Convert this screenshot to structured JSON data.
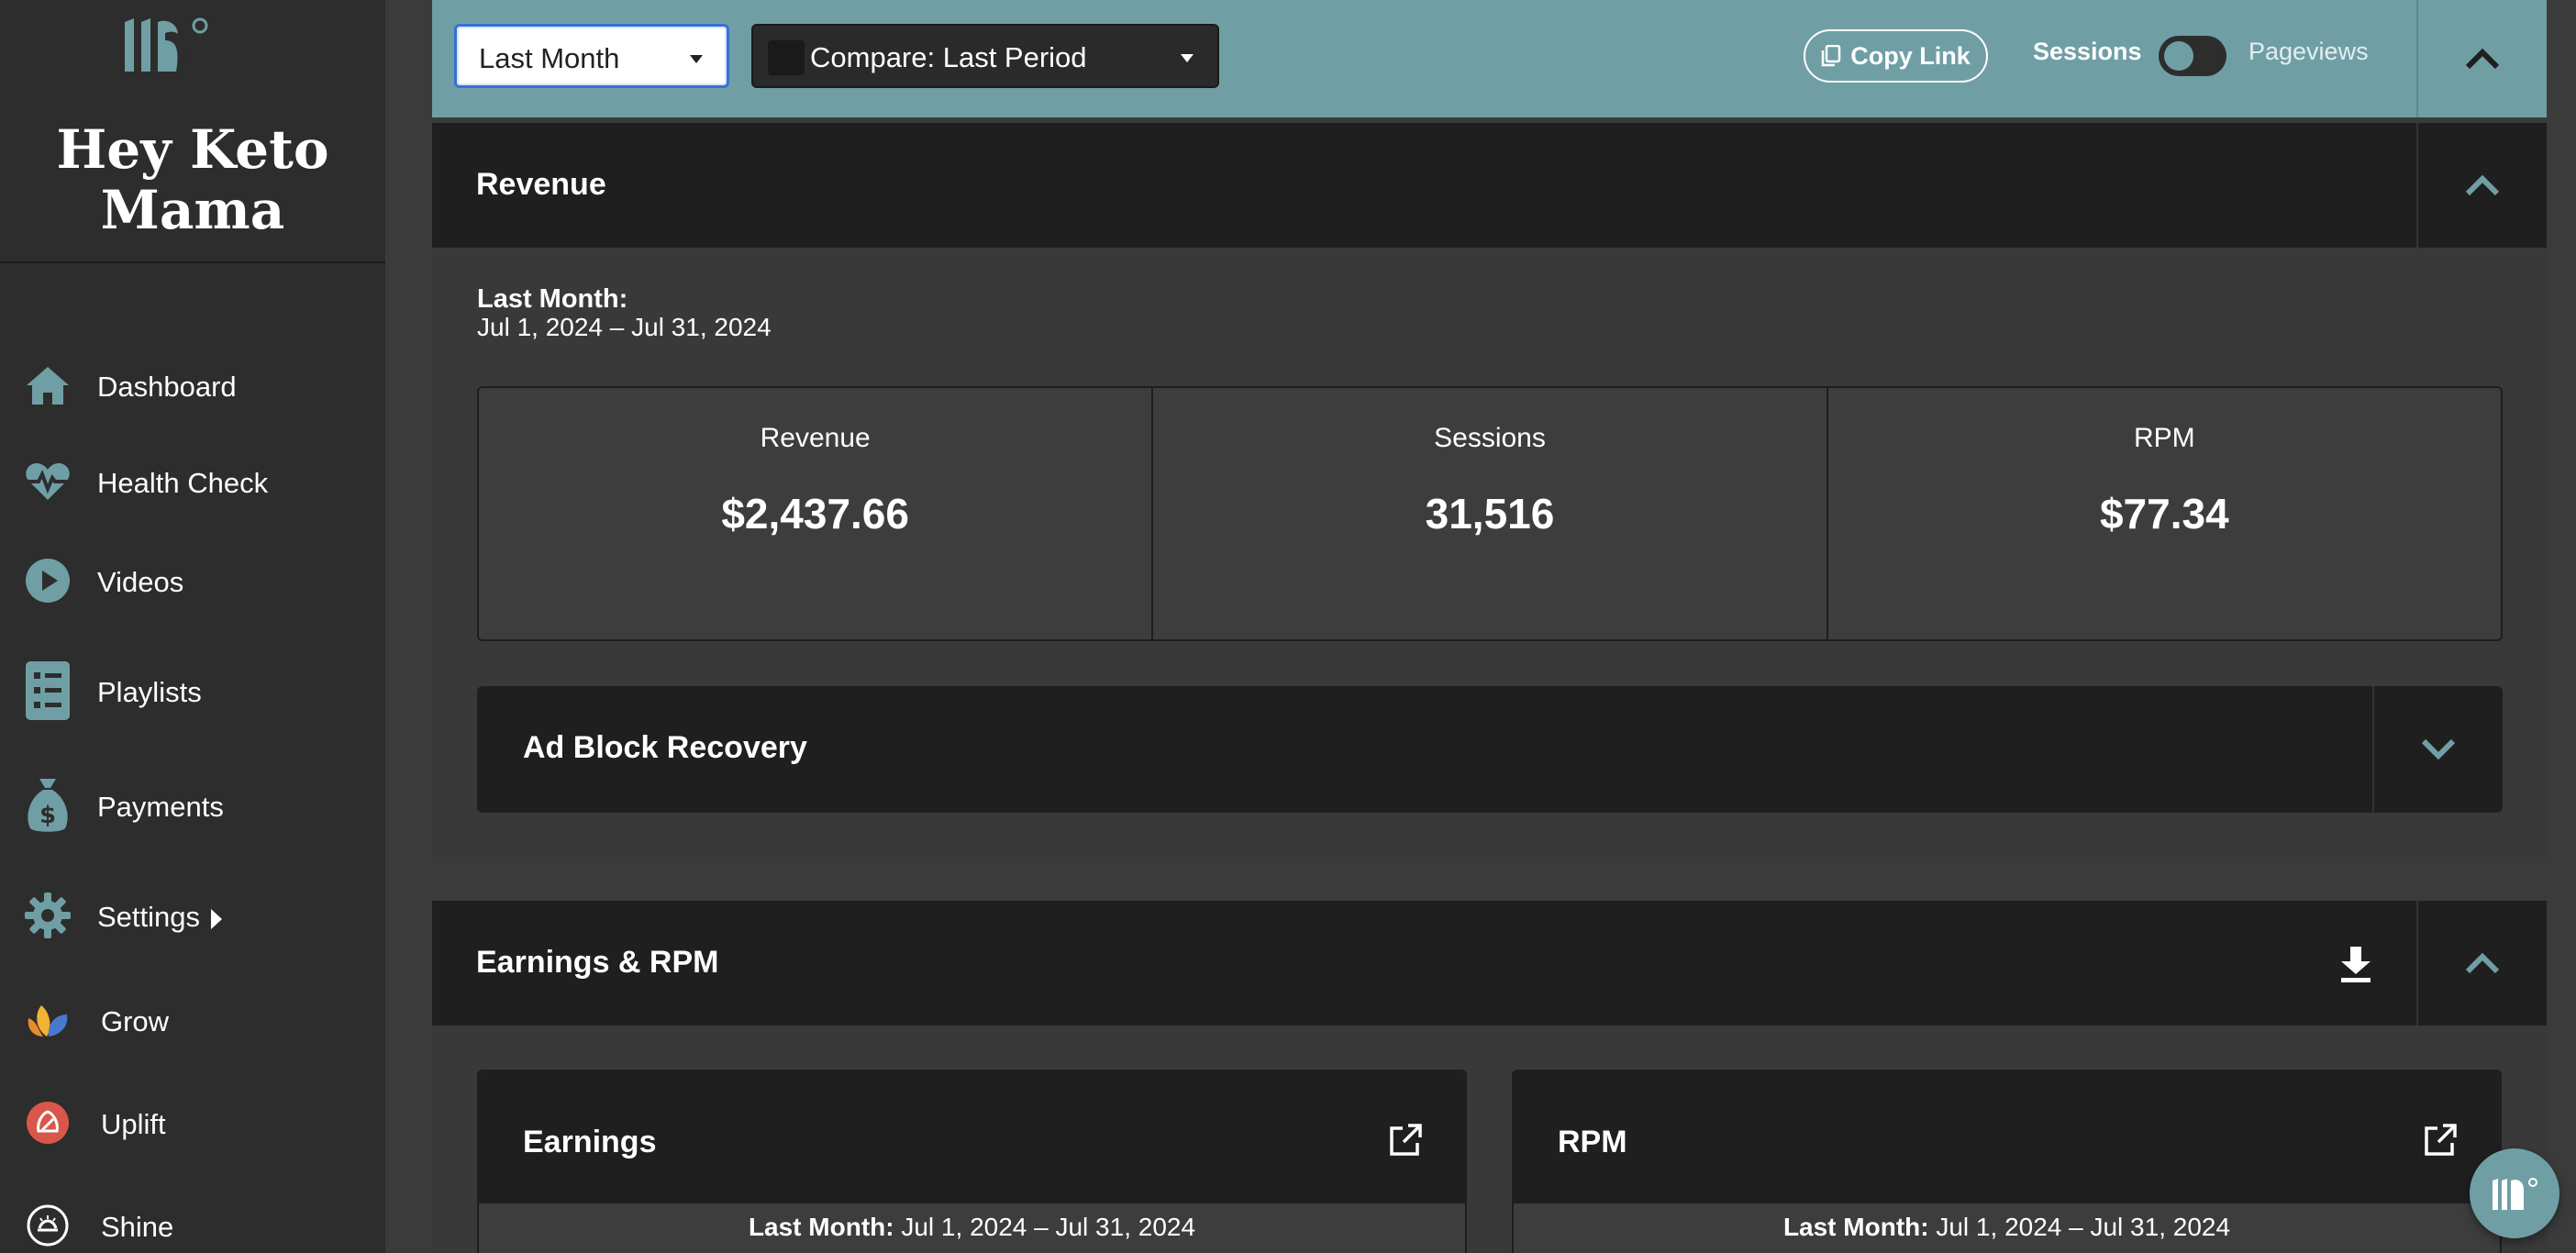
{
  "sidebar": {
    "brand_line1": "Hey Keto",
    "brand_line2": "Mama",
    "items": [
      {
        "label": "Dashboard",
        "icon": "home-icon"
      },
      {
        "label": "Health Check",
        "icon": "heartbeat-icon"
      },
      {
        "label": "Videos",
        "icon": "play-circle-icon"
      },
      {
        "label": "Playlists",
        "icon": "list-icon"
      },
      {
        "label": "Payments",
        "icon": "money-bag-icon"
      },
      {
        "label": "Settings",
        "icon": "gear-icon"
      },
      {
        "label": "Grow",
        "icon": "grow-logo-icon"
      },
      {
        "label": "Uplift",
        "icon": "uplift-logo-icon"
      },
      {
        "label": "Shine",
        "icon": "shine-logo-icon"
      }
    ]
  },
  "filters": {
    "date_range": "Last Month",
    "compare": "Compare: Last Period",
    "copy_link": "Copy Link",
    "toggle_left": "Sessions",
    "toggle_right": "Pageviews"
  },
  "revenue": {
    "title": "Revenue",
    "period_label": "Last Month:",
    "period_range": "Jul 1, 2024 – Jul 31, 2024",
    "stats": [
      {
        "label": "Revenue",
        "value": "$2,437.66"
      },
      {
        "label": "Sessions",
        "value": "31,516"
      },
      {
        "label": "RPM",
        "value": "$77.34"
      }
    ],
    "adblock_title": "Ad Block Recovery"
  },
  "earnings": {
    "title": "Earnings & RPM",
    "cards": [
      {
        "title": "Earnings",
        "period_label": "Last Month:",
        "period_range": "Jul 1, 2024 – Jul 31, 2024"
      },
      {
        "title": "RPM",
        "period_label": "Last Month:",
        "period_range": "Jul 1, 2024 – Jul 31, 2024"
      }
    ]
  },
  "colors": {
    "accent": "#6f9fa5",
    "sidebar_bg": "#2d2d2d",
    "panel_header": "#1f1f1f",
    "content_bg": "#393939"
  }
}
